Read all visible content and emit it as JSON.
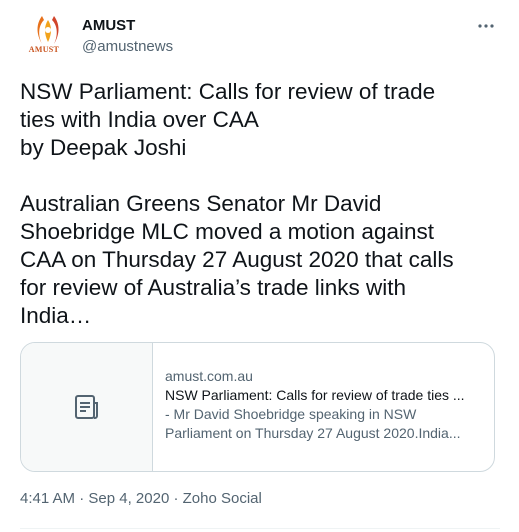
{
  "account": {
    "name": "AMUST",
    "handle": "@amustnews",
    "avatar_label": "AMUST",
    "avatar_icon": "amust-logo-icon",
    "brand_color": "#c8511b"
  },
  "tweet": {
    "paragraphs": [
      "NSW Parliament: Calls for review of trade\nties with India over CAA\nby Deepak Joshi",
      "Australian Greens Senator Mr David\nShoebridge MLC moved a motion against\nCAA on Thursday 27 August 2020 that calls\nfor review of Australia’s trade links with\nIndia…"
    ]
  },
  "more_icon": "more-horizontal-icon",
  "link_card": {
    "thumbnail_icon": "article-icon",
    "domain": "amust.com.au",
    "title": "NSW Parliament: Calls for review of trade ties ...",
    "description_line1": "- Mr David Shoebridge speaking in NSW",
    "description_line2": "Parliament on Thursday 27 August 2020.India..."
  },
  "meta": {
    "time": "4:41 AM",
    "separator": " · ",
    "date": "Sep 4, 2020",
    "source": "Zoho Social"
  },
  "colors": {
    "text_primary": "#0f1419",
    "text_secondary": "#536471",
    "border": "#cfd9de"
  }
}
